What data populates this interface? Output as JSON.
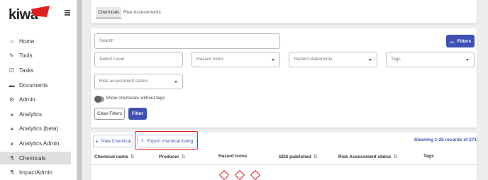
{
  "brand": {
    "logo_text": "kiwa"
  },
  "sidebar": {
    "items": [
      {
        "label": "Home",
        "icon": "home-icon"
      },
      {
        "label": "Tools",
        "icon": "edit-icon"
      },
      {
        "label": "Tasks",
        "icon": "checkbox-icon"
      },
      {
        "label": "Documents",
        "icon": "folder-icon"
      },
      {
        "label": "Admin",
        "icon": "cogs-icon"
      },
      {
        "label": "Analytics",
        "icon": "pie-chart-icon"
      },
      {
        "label": "Analytics (beta)",
        "icon": "pie-chart-icon"
      },
      {
        "label": "Analytics Admin",
        "icon": "pie-chart-icon"
      },
      {
        "label": "Chemicals",
        "icon": "flask-icon"
      },
      {
        "label": "ImpactAdmin",
        "icon": "flask-icon"
      }
    ],
    "active": "Chemicals"
  },
  "tabs": [
    {
      "label": "Chemicals"
    },
    {
      "label": "Risk Assessments"
    }
  ],
  "filters": {
    "search_placeholder": "Search",
    "filters_button": "Filters",
    "select_level": "Select Level",
    "hazard_icons": "Hazard Icons",
    "hazard_statements": "Hazard statements",
    "tags": "Tags",
    "risk_status": "Risk assessment status",
    "toggle_label": "Show chemicals without tags",
    "clear_button": "Clear Filters",
    "filter_button": "Filter"
  },
  "table": {
    "new_button": "New Chemical",
    "export_button": "Export chemical listing",
    "records": "Showing 1-25 records of 271",
    "columns": [
      "Chemical name",
      "Producer",
      "Hazard Icons",
      "SDS published",
      "Risk Assessment status",
      "Tags"
    ]
  },
  "colors": {
    "accent": "#3f51b5",
    "brand_red": "#e02020",
    "highlight": "#e02020"
  }
}
